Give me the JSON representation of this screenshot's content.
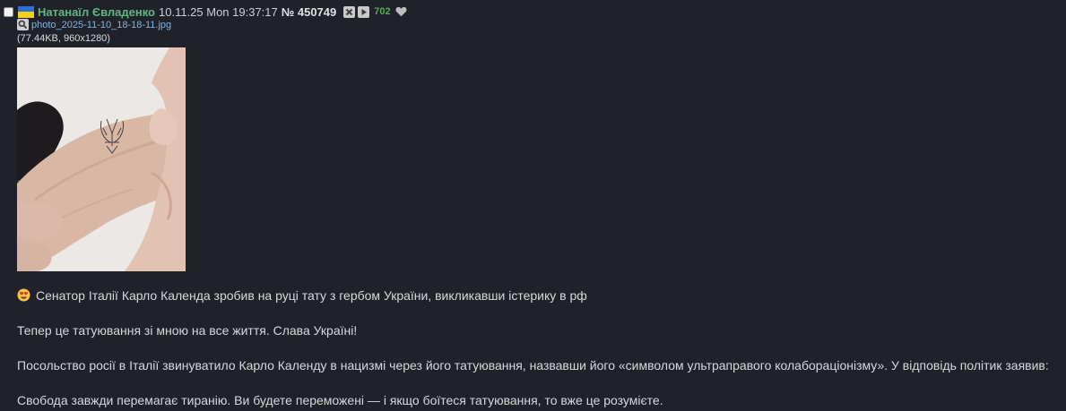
{
  "post": {
    "name": "Натанаїл Євладенко",
    "date": "10.11.25 Mon 19:37:17",
    "number": "№ 450749",
    "views": "702",
    "flag_colors": [
      "#2f6fd6",
      "#f2d11b"
    ],
    "name_color": "#62b482",
    "icons": [
      "checkbox",
      "ukraine-flag-icon",
      "close-icon",
      "play-icon",
      "heart-icon",
      "magnifier-icon"
    ]
  },
  "file": {
    "name": "photo_2025-11-10_18-18-11.jpg",
    "meta": "(77.44KB, 960x1280)"
  },
  "body": {
    "p1": "Сенатор Італії Карло Календа зробив на руці тату з гербом України, викликавши істерику в рф",
    "p2": "Тепер це татуювання зі мною на все життя. Слава Україні!",
    "p3": "Посольство росії в Італії звинуватило Карло Календу в нацизмі через його татуювання, назвавши його «символом ультраправого колабораціонізму». У відповідь політик заявив:",
    "p4": "Свобода завжди перемагає тиранію. Ви будете переможені — і якщо боїтеся татуювання, то вже це розумієте."
  }
}
